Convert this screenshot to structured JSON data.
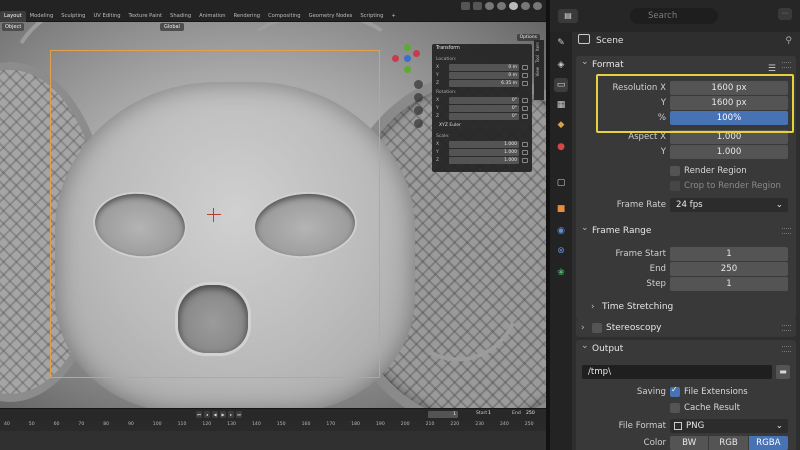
{
  "workspace_tabs": [
    "Layout",
    "Modeling",
    "Sculpting",
    "UV Editing",
    "Texture Paint",
    "Shading",
    "Animation",
    "Rendering",
    "Compositing",
    "Geometry Nodes",
    "Scripting",
    "+"
  ],
  "viewport": {
    "mode_label": "Object",
    "orientation": "Global",
    "options_label": "Options"
  },
  "n_panel": {
    "title": "Transform",
    "location_label": "Location:",
    "location": [
      {
        "axis": "X",
        "value": "0 m"
      },
      {
        "axis": "Y",
        "value": "0 m"
      },
      {
        "axis": "Z",
        "value": "6.35 m"
      }
    ],
    "rotation_label": "Rotation:",
    "rotation": [
      {
        "axis": "X",
        "value": "0°"
      },
      {
        "axis": "Y",
        "value": "0°"
      },
      {
        "axis": "Z",
        "value": "0°"
      }
    ],
    "rotation_mode": "XYZ Euler",
    "scale_label": "Scale:",
    "scale": [
      {
        "axis": "X",
        "value": "1.000"
      },
      {
        "axis": "Y",
        "value": "1.000"
      },
      {
        "axis": "Z",
        "value": "1.000"
      }
    ],
    "side_tabs": [
      "Item",
      "Tool",
      "View"
    ]
  },
  "timeline": {
    "current_frame": "1",
    "start_label": "Start",
    "start_value": "1",
    "end_label": "End",
    "end_value": "250",
    "ruler": [
      "40",
      "50",
      "60",
      "70",
      "80",
      "90",
      "100",
      "110",
      "120",
      "130",
      "140",
      "150",
      "160",
      "170",
      "180",
      "190",
      "200",
      "210",
      "220",
      "230",
      "240",
      "250"
    ]
  },
  "properties": {
    "search_placeholder": "Search",
    "context": "Scene",
    "format": {
      "title": "Format",
      "resolution_x_label": "Resolution X",
      "resolution_x": "1600 px",
      "y_label": "Y",
      "resolution_y": "1600 px",
      "percent_label": "%",
      "percent": "100%",
      "aspect_x_label": "Aspect X",
      "aspect_x": "1.000",
      "aspect_y_label": "Y",
      "aspect_y": "1.000",
      "render_region": "Render Region",
      "crop_region": "Crop to Render Region",
      "frame_rate_label": "Frame Rate",
      "frame_rate": "24 fps"
    },
    "frame_range": {
      "title": "Frame Range",
      "start_label": "Frame Start",
      "start": "1",
      "end_label": "End",
      "end": "250",
      "step_label": "Step",
      "step": "1",
      "time_stretching": "Time Stretching"
    },
    "stereoscopy": {
      "title": "Stereoscopy"
    },
    "output": {
      "title": "Output",
      "path": "/tmp\\",
      "saving_label": "Saving",
      "file_extensions": "File Extensions",
      "cache_result": "Cache Result",
      "file_format_label": "File Format",
      "file_format": "PNG",
      "color_label": "Color",
      "color_options": [
        "BW",
        "RGB",
        "RGBA"
      ],
      "color_selected": "RGBA"
    }
  },
  "colors": {
    "accent_blue": "#4772b3",
    "highlight_yellow": "#e6d23a",
    "camera_frame": "#e0a050"
  }
}
